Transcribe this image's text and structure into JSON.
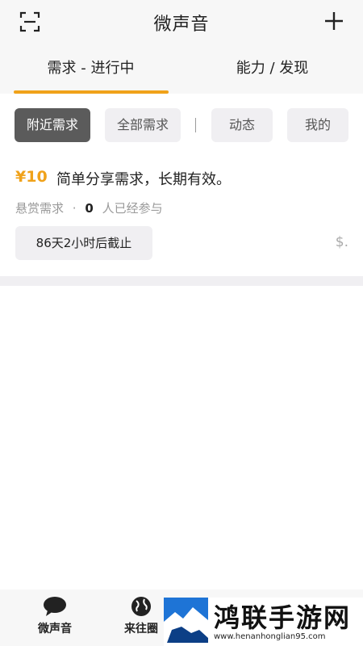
{
  "header": {
    "title": "微声音",
    "left_icon": "scan-icon",
    "right_icon": "plus-icon"
  },
  "main_tabs": [
    {
      "label": "需求 - 进行中",
      "active": true
    },
    {
      "label": "能力 / 发现",
      "active": false
    }
  ],
  "filters": [
    {
      "label": "附近需求",
      "active": true
    },
    {
      "label": "全部需求",
      "active": false
    },
    {
      "label": "动态",
      "active": false
    },
    {
      "label": "我的",
      "active": false
    }
  ],
  "task": {
    "reward": "¥10",
    "title": "简单分享需求，长期有效。",
    "category": "悬赏需求",
    "separator": "·",
    "participants": "0",
    "participants_suffix": "人已经参与",
    "deadline": "86天2小时后截止",
    "action": "$."
  },
  "bottom_nav": [
    {
      "label": "微声音",
      "icon": "chat-bubble-icon"
    },
    {
      "label": "来往圈",
      "icon": "globe-icon"
    }
  ],
  "watermark": {
    "text": "鸿联手游网",
    "url": "www.henanhonglian95.com"
  },
  "colors": {
    "accent": "#f0a21a",
    "chip_active": "#5b5b5b",
    "chip_bg": "#f0eff2",
    "bar_bg": "#f7f7f7"
  }
}
